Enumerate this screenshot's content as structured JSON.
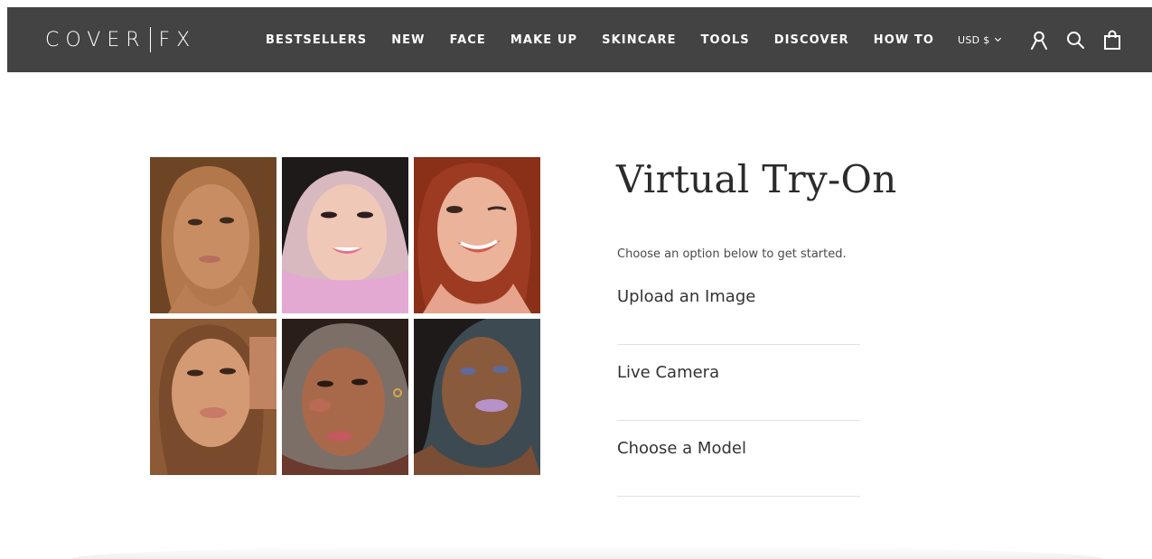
{
  "header": {
    "logo_left": "COVER",
    "logo_right": "FX",
    "nav": [
      {
        "label": "BESTSELLERS"
      },
      {
        "label": "NEW"
      },
      {
        "label": "FACE"
      },
      {
        "label": "MAKE UP"
      },
      {
        "label": "SKINCARE"
      },
      {
        "label": "TOOLS"
      },
      {
        "label": "DISCOVER"
      },
      {
        "label": "HOW TO"
      }
    ],
    "currency": "USD $",
    "icons": [
      "account-icon",
      "search-icon",
      "cart-icon"
    ]
  },
  "main": {
    "title": "Virtual Try-On",
    "subtitle": "Choose an option below to get started.",
    "options": [
      {
        "label": "Upload an Image"
      },
      {
        "label": "Live Camera"
      },
      {
        "label": "Choose a Model"
      }
    ]
  },
  "colors": {
    "header_bg": "#434343",
    "header_text": "#ffffff",
    "divider": "#e2e2e2"
  }
}
